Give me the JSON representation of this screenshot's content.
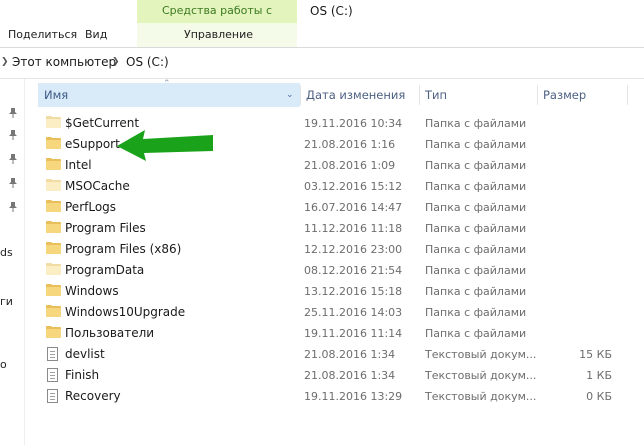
{
  "ribbon": {
    "disk_tools": "Средства работы с дисками",
    "manage_tab": "Управление",
    "window_title": "OS (C:)",
    "tabs": [
      "Поделиться",
      "Вид"
    ]
  },
  "address": {
    "segments": [
      "Этот компьютер",
      "OS (C:)"
    ]
  },
  "nav_fragments": [
    "ds",
    "ги",
    "о"
  ],
  "columns": {
    "name": "Имя",
    "date": "Дата изменения",
    "type": "Тип",
    "size": "Размер"
  },
  "files": [
    {
      "name": "$GetCurrent",
      "date": "19.11.2016 10:34",
      "type": "Папка с файлами",
      "size": "",
      "icon": "folder-light"
    },
    {
      "name": "eSupport",
      "date": "21.08.2016 1:16",
      "type": "Папка с файлами",
      "size": "",
      "icon": "folder"
    },
    {
      "name": "Intel",
      "date": "21.08.2016 1:09",
      "type": "Папка с файлами",
      "size": "",
      "icon": "folder"
    },
    {
      "name": "MSOCache",
      "date": "03.12.2016 15:12",
      "type": "Папка с файлами",
      "size": "",
      "icon": "folder-light"
    },
    {
      "name": "PerfLogs",
      "date": "16.07.2016 14:47",
      "type": "Папка с файлами",
      "size": "",
      "icon": "folder"
    },
    {
      "name": "Program Files",
      "date": "11.12.2016 11:18",
      "type": "Папка с файлами",
      "size": "",
      "icon": "folder"
    },
    {
      "name": "Program Files (x86)",
      "date": "12.12.2016 23:00",
      "type": "Папка с файлами",
      "size": "",
      "icon": "folder"
    },
    {
      "name": "ProgramData",
      "date": "08.12.2016 21:54",
      "type": "Папка с файлами",
      "size": "",
      "icon": "folder-light"
    },
    {
      "name": "Windows",
      "date": "13.12.2016 15:18",
      "type": "Папка с файлами",
      "size": "",
      "icon": "folder"
    },
    {
      "name": "Windows10Upgrade",
      "date": "25.11.2016 14:03",
      "type": "Папка с файлами",
      "size": "",
      "icon": "folder"
    },
    {
      "name": "Пользователи",
      "date": "19.11.2016 11:14",
      "type": "Папка с файлами",
      "size": "",
      "icon": "folder"
    },
    {
      "name": "devlist",
      "date": "21.08.2016 1:34",
      "type": "Текстовый докум...",
      "size": "15 КБ",
      "icon": "document"
    },
    {
      "name": "Finish",
      "date": "21.08.2016 1:34",
      "type": "Текстовый докум...",
      "size": "1 КБ",
      "icon": "document"
    },
    {
      "name": "Recovery",
      "date": "19.11.2016 13:29",
      "type": "Текстовый докум...",
      "size": "0 КБ",
      "icon": "document"
    }
  ],
  "annotation": {
    "arrow_icon": "green-arrow-icon",
    "arrow_color": "#1aa31a"
  }
}
